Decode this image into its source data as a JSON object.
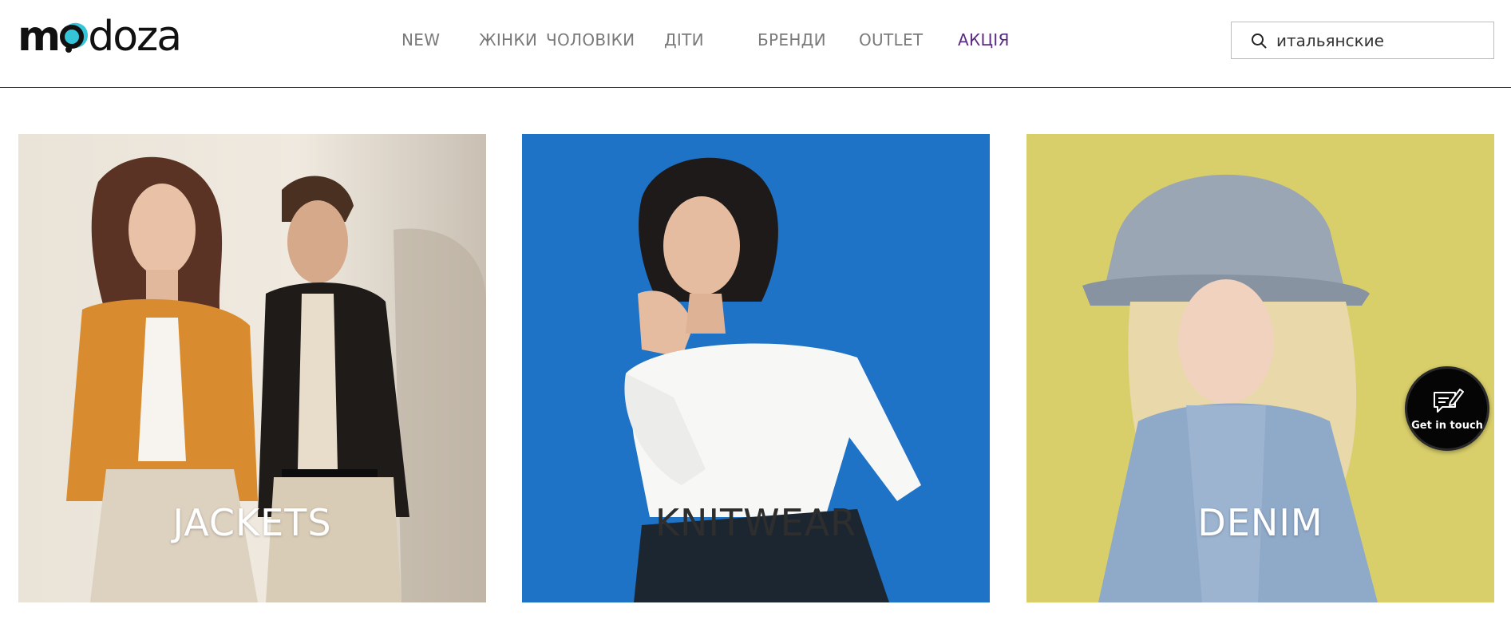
{
  "brand": {
    "logo_text": "modoza"
  },
  "nav": {
    "items": [
      {
        "label": "NEW"
      },
      {
        "label": "ЖІНКИ"
      },
      {
        "label": "ЧОЛОВІКИ"
      },
      {
        "label": "ДІТИ"
      },
      {
        "label": "БРЕНДИ"
      },
      {
        "label": "OUTLET"
      },
      {
        "label": "АКЦІЯ"
      }
    ],
    "sale_color": "#5b2b82",
    "default_color": "#7a7a7a"
  },
  "search": {
    "value": "итальянские",
    "icon": "search-icon"
  },
  "categories": [
    {
      "label": "JACKETS"
    },
    {
      "label": "KNITWEAR"
    },
    {
      "label": "DENIM"
    }
  ],
  "contact_widget": {
    "label": "Get in touch",
    "icon": "chat-edit-icon"
  },
  "colors": {
    "accent": "#5b2b82",
    "logo_dot": "#35c5d8",
    "knitwear_bg": "#1e73c6",
    "denim_bg": "#d9cf6a"
  }
}
